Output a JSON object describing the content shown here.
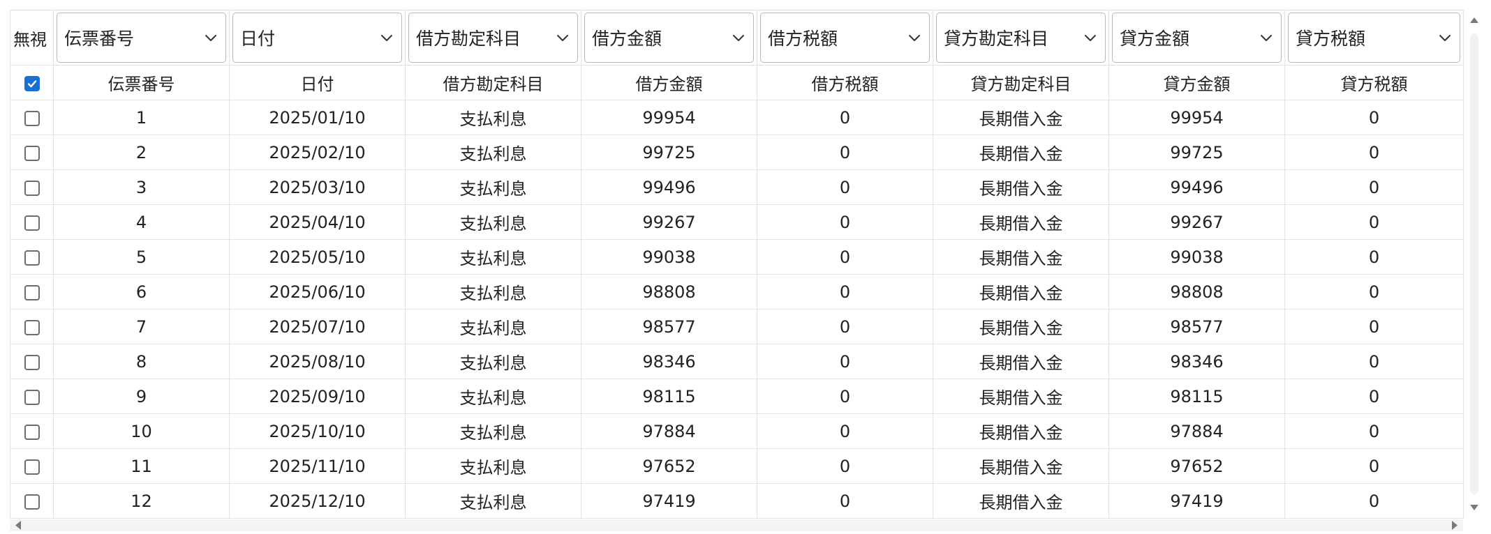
{
  "ignore_label": "無視",
  "select_all_checked": true,
  "column_selects": [
    {
      "value": "伝票番号"
    },
    {
      "value": "日付"
    },
    {
      "value": "借方勘定科目"
    },
    {
      "value": "借方金額"
    },
    {
      "value": "借方税額"
    },
    {
      "value": "貸方勘定科目"
    },
    {
      "value": "貸方金額"
    },
    {
      "value": "貸方税額"
    }
  ],
  "headers": [
    "伝票番号",
    "日付",
    "借方勘定科目",
    "借方金額",
    "借方税額",
    "貸方勘定科目",
    "貸方金額",
    "貸方税額"
  ],
  "rows": [
    {
      "checked": false,
      "cells": [
        "1",
        "2025/01/10",
        "支払利息",
        "99954",
        "0",
        "長期借入金",
        "99954",
        "0"
      ]
    },
    {
      "checked": false,
      "cells": [
        "2",
        "2025/02/10",
        "支払利息",
        "99725",
        "0",
        "長期借入金",
        "99725",
        "0"
      ]
    },
    {
      "checked": false,
      "cells": [
        "3",
        "2025/03/10",
        "支払利息",
        "99496",
        "0",
        "長期借入金",
        "99496",
        "0"
      ]
    },
    {
      "checked": false,
      "cells": [
        "4",
        "2025/04/10",
        "支払利息",
        "99267",
        "0",
        "長期借入金",
        "99267",
        "0"
      ]
    },
    {
      "checked": false,
      "cells": [
        "5",
        "2025/05/10",
        "支払利息",
        "99038",
        "0",
        "長期借入金",
        "99038",
        "0"
      ]
    },
    {
      "checked": false,
      "cells": [
        "6",
        "2025/06/10",
        "支払利息",
        "98808",
        "0",
        "長期借入金",
        "98808",
        "0"
      ]
    },
    {
      "checked": false,
      "cells": [
        "7",
        "2025/07/10",
        "支払利息",
        "98577",
        "0",
        "長期借入金",
        "98577",
        "0"
      ]
    },
    {
      "checked": false,
      "cells": [
        "8",
        "2025/08/10",
        "支払利息",
        "98346",
        "0",
        "長期借入金",
        "98346",
        "0"
      ]
    },
    {
      "checked": false,
      "cells": [
        "9",
        "2025/09/10",
        "支払利息",
        "98115",
        "0",
        "長期借入金",
        "98115",
        "0"
      ]
    },
    {
      "checked": false,
      "cells": [
        "10",
        "2025/10/10",
        "支払利息",
        "97884",
        "0",
        "長期借入金",
        "97884",
        "0"
      ]
    },
    {
      "checked": false,
      "cells": [
        "11",
        "2025/11/10",
        "支払利息",
        "97652",
        "0",
        "長期借入金",
        "97652",
        "0"
      ]
    },
    {
      "checked": false,
      "cells": [
        "12",
        "2025/12/10",
        "支払利息",
        "97419",
        "0",
        "長期借入金",
        "97419",
        "0"
      ]
    }
  ],
  "colors": {
    "checkbox_checked": "#1a6fd4",
    "grid_line": "#e4e4e4"
  }
}
